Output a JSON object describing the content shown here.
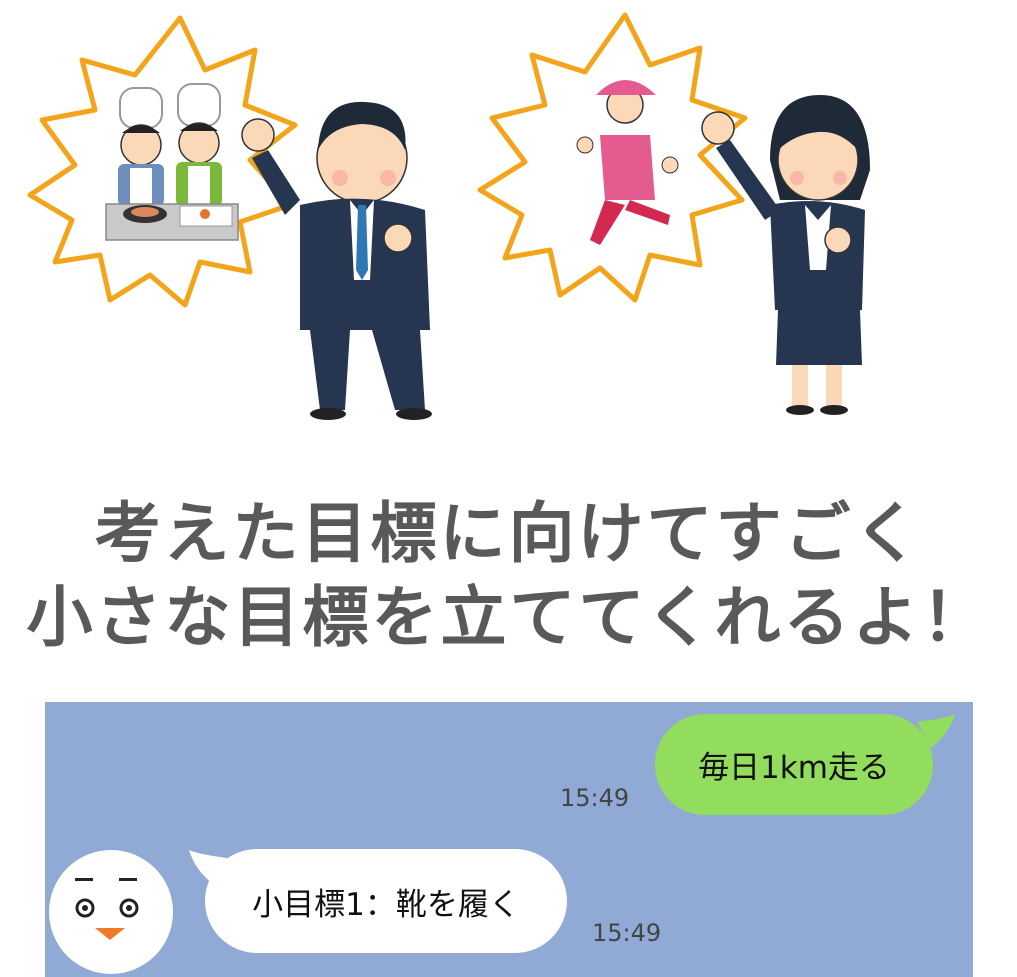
{
  "headline": {
    "line1": "考えた目標に向けてすごく",
    "line2": "小さな目標を立ててくれるよ！"
  },
  "chat": {
    "messages": [
      {
        "side": "right",
        "text": "毎日1km走る",
        "time": "15:49"
      },
      {
        "side": "left",
        "text": "小目標1：靴を履く",
        "time": "15:49"
      }
    ]
  },
  "colors": {
    "headline_text": "#595959",
    "chat_background": "#90a9d5",
    "sent_bubble": "#92dd5d",
    "received_bubble": "#ffffff",
    "burst_outline": "#f3a41a",
    "suit": "#263650"
  },
  "icons": {
    "left_thought": "cooking-chefs-illustration",
    "left_person": "businessman-fist-pump",
    "right_thought": "jogging-woman-illustration",
    "right_person": "businesswoman-fist-pump",
    "avatar": "bot-face-avatar"
  }
}
